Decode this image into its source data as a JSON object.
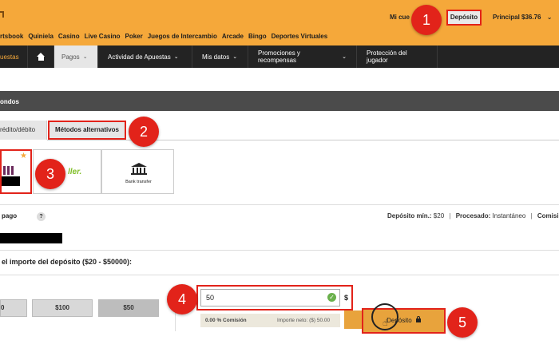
{
  "header": {
    "my_account_label": "Mi cue",
    "deposit_label": "Depósito",
    "balance_label": "Principal",
    "balance_value": "$36.76"
  },
  "sports_nav": [
    "rtsbook",
    "Quiniela",
    "Casino",
    "Live Casino",
    "Poker",
    "Juegos de Intercambio",
    "Arcade",
    "Bingo",
    "Deportes Virtuales"
  ],
  "main_nav": {
    "bets_label": "uestas",
    "payments_label": "Pagos",
    "activity_label": "Actividad de Apuestas",
    "my_data_label": "Mis datos",
    "promos_label": "Promociones y recompensas",
    "protection_label": "Protección del jugador"
  },
  "section": {
    "title": "ondos"
  },
  "tabs": {
    "card_label": "rédito/débito",
    "alt_label": "Métodos alternativos"
  },
  "payment_methods": {
    "brand_fragment": "ller.",
    "bank_label": "Bank transfer"
  },
  "payment_info": {
    "method_label": "pago",
    "help": "?",
    "min_deposit_label": "Depósito mín.:",
    "min_deposit_value": "$20",
    "processed_label": "Procesado:",
    "processed_value": "Instantáneo",
    "commission_label": "Comisi"
  },
  "deposit_form": {
    "amount_prompt": "el importe del depósito ($20 - $50000):",
    "quick_amounts": [
      "0",
      "$100",
      "$50"
    ],
    "amount_value": "50",
    "currency": "$",
    "commission_text": "0.00 % Comisión",
    "net_amount_text": "Importe neto: ($) 50.00",
    "submit_label": "Depósito"
  },
  "annotations": [
    "1",
    "2",
    "3",
    "4",
    "5"
  ],
  "icons": [
    "home-icon",
    "chevron-down-icon",
    "star-icon",
    "bank-icon",
    "check-icon",
    "lock-icon",
    "hand-cursor-icon"
  ],
  "colors": {
    "accent": "#f5a83a",
    "nav": "#232323",
    "highlight": "#e2231a"
  }
}
